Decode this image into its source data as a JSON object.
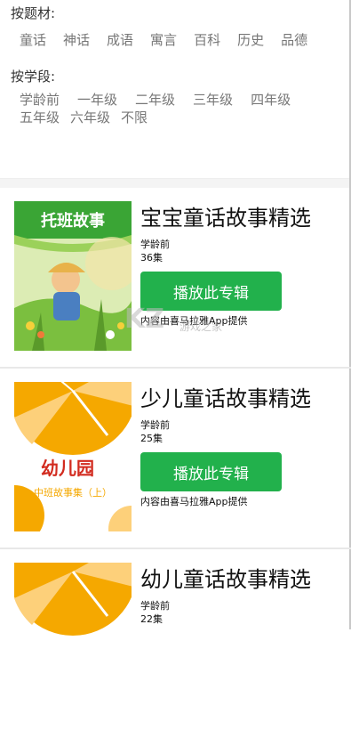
{
  "filters": {
    "topic_label": "按题材:",
    "topics": [
      "童话",
      "神话",
      "成语",
      "寓言",
      "百科",
      "历史",
      "品德"
    ],
    "stage_label": "按学段:",
    "stages_row1": [
      "学龄前",
      "一年级",
      "二年级",
      "三年级",
      "四年级"
    ],
    "stages_row2": [
      "五年级",
      "六年级",
      "不限"
    ]
  },
  "albums": [
    {
      "title": "宝宝童话故事精选",
      "stage": "学龄前",
      "episodes": "36集",
      "play_label": "播放此专辑",
      "credit": "内容由喜马拉雅App提供",
      "cover_text": "托班故事"
    },
    {
      "title": "少儿童话故事精选",
      "stage": "学龄前",
      "episodes": "25集",
      "play_label": "播放此专辑",
      "credit": "内容由喜马拉雅App提供",
      "cover_text_main": "幼儿园",
      "cover_text_sub": "中班故事集（上）"
    },
    {
      "title": "幼儿童话故事精选",
      "stage": "学龄前",
      "episodes": "22集"
    }
  ],
  "watermark": {
    "logo": "KZ",
    "text": "游戏之家"
  },
  "colors": {
    "accent": "#22b14c",
    "tag": "#777777",
    "cover_green": "#3aa535",
    "cover_orange": "#f5a800"
  }
}
